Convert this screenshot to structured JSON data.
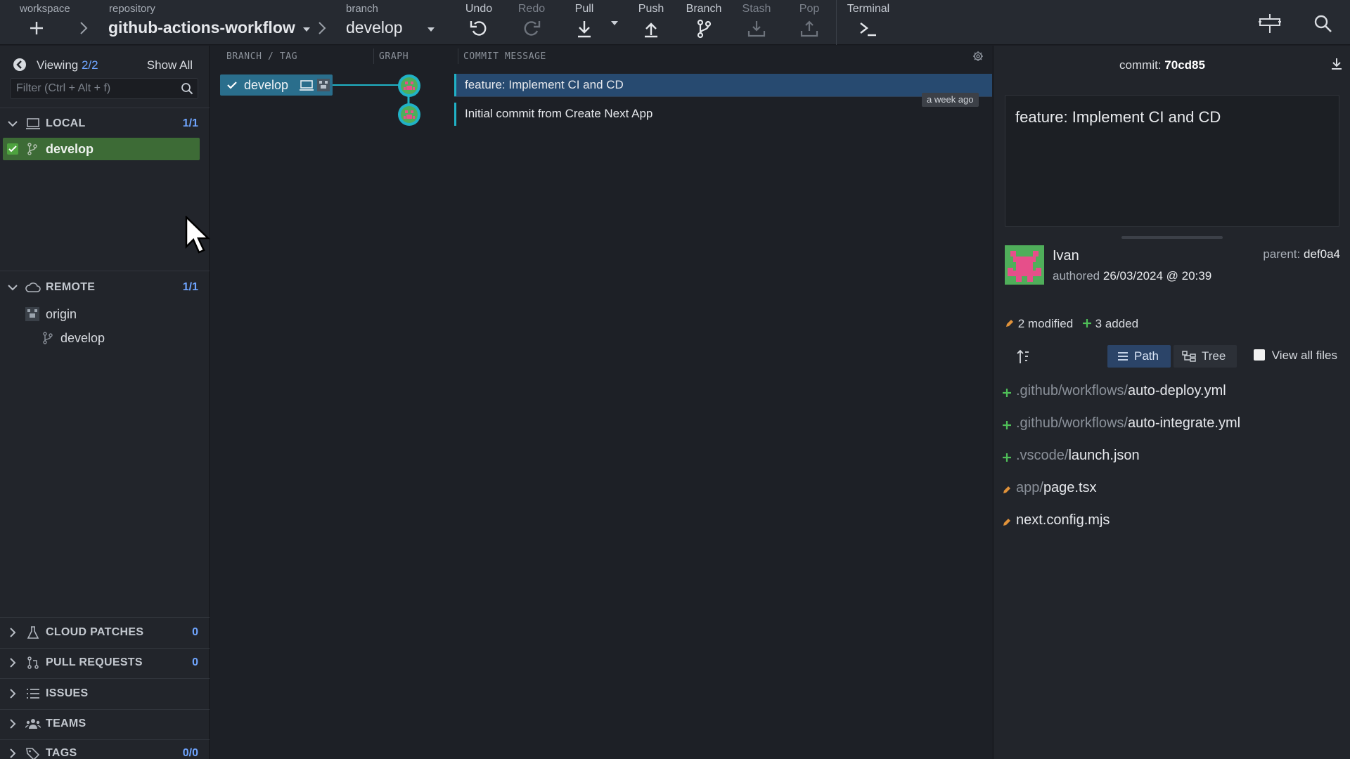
{
  "toolbar": {
    "workspace_label": "workspace",
    "repository_label": "repository",
    "repository_name": "github-actions-workflow",
    "branch_label": "branch",
    "branch_name": "develop",
    "buttons": [
      {
        "label": "Undo",
        "icon": "undo-icon"
      },
      {
        "label": "Redo",
        "icon": "redo-icon"
      },
      {
        "label": "Pull",
        "icon": "pull-icon"
      },
      {
        "label": "Push",
        "icon": "push-icon"
      },
      {
        "label": "Branch",
        "icon": "branch-icon"
      },
      {
        "label": "Stash",
        "icon": "stash-icon"
      },
      {
        "label": "Pop",
        "icon": "pop-icon"
      },
      {
        "label": "Terminal",
        "icon": "terminal-icon"
      }
    ]
  },
  "left_panel": {
    "viewing_label": "Viewing",
    "viewing_count": "2/2",
    "show_all": "Show All",
    "filter_placeholder": "Filter (Ctrl + Alt + f)",
    "local": {
      "title": "LOCAL",
      "count": "1/1",
      "branch": "develop"
    },
    "remote": {
      "title": "REMOTE",
      "count": "1/1",
      "origin": "origin",
      "branch": "develop"
    },
    "cloud_patches": {
      "title": "CLOUD PATCHES",
      "count": "0"
    },
    "pull_requests": {
      "title": "PULL REQUESTS",
      "count": "0"
    },
    "issues": {
      "title": "ISSUES"
    },
    "teams": {
      "title": "TEAMS"
    },
    "tags": {
      "title": "TAGS",
      "count": "0/0"
    }
  },
  "graph": {
    "columns": {
      "branch_tag": "BRANCH / TAG",
      "graph": "GRAPH",
      "message": "COMMIT MESSAGE"
    },
    "branch_pill": "develop",
    "commits": [
      {
        "message": "feature: Implement CI and CD"
      },
      {
        "message": "Initial commit from Create Next App"
      }
    ],
    "time_badge": "a week ago"
  },
  "detail": {
    "commit_label": "commit:",
    "commit_sha": "70cd85",
    "message_title": "feature: Implement CI and CD",
    "author": "Ivan",
    "authored_label": "authored",
    "authored_date": "26/03/2024 @ 20:39",
    "parent_label": "parent:",
    "parent_sha": "def0a4",
    "modified": "2 modified",
    "added": "3 added",
    "path_label": "Path",
    "tree_label": "Tree",
    "view_all_label": "View all files",
    "files": [
      {
        "status": "added",
        "dir": ".github/workflows/",
        "name": "auto-deploy.yml"
      },
      {
        "status": "added",
        "dir": ".github/workflows/",
        "name": "auto-integrate.yml"
      },
      {
        "status": "added",
        "dir": ".vscode/",
        "name": "launch.json"
      },
      {
        "status": "modified",
        "dir": "app/",
        "name": "page.tsx"
      },
      {
        "status": "modified",
        "dir": "",
        "name": "next.config.mjs"
      }
    ]
  },
  "colors": {
    "accent_blue": "#6fa5ff",
    "added_green": "#4fbf58",
    "modified_orange": "#e0923a",
    "graph_teal": "#20b2c6",
    "local_green": "#3d6b36"
  }
}
